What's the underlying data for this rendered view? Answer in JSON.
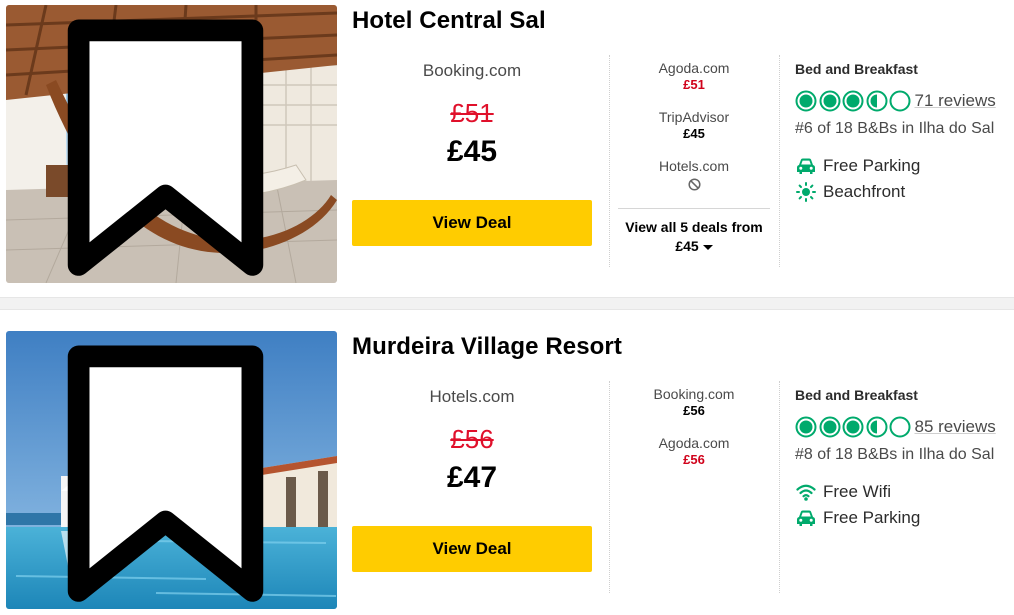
{
  "colors": {
    "accent_green": "#00aa6c",
    "deal_button": "#ffcc00",
    "strike_red": "#e0102b",
    "price_red": "#d0021b"
  },
  "hotels": [
    {
      "name": "Hotel Central Sal",
      "main_provider": "Booking.com",
      "old_price": "£51",
      "price": "£45",
      "view_deal": "View Deal",
      "other_deals": [
        {
          "provider": "Agoda.com",
          "price": "£51",
          "price_style": "red"
        },
        {
          "provider": "TripAdvisor",
          "price": "£45",
          "price_style": "normal"
        },
        {
          "provider": "Hotels.com",
          "price": "",
          "icon": "unavailable-icon"
        }
      ],
      "view_all_line1": "View all 5 deals from",
      "view_all_line2": "£45",
      "property_type": "Bed and Breakfast",
      "rating": 3.5,
      "reviews": "71 reviews",
      "rank": "#6 of 18 B&Bs in Ilha do Sal",
      "amenities": [
        {
          "icon": "car-icon",
          "label": "Free Parking"
        },
        {
          "icon": "sun-icon",
          "label": "Beachfront"
        }
      ]
    },
    {
      "name": "Murdeira Village Resort",
      "main_provider": "Hotels.com",
      "old_price": "£56",
      "price": "£47",
      "view_deal": "View Deal",
      "other_deals": [
        {
          "provider": "Booking.com",
          "price": "£56",
          "price_style": "normal"
        },
        {
          "provider": "Agoda.com",
          "price": "£56",
          "price_style": "red"
        }
      ],
      "property_type": "Bed and Breakfast",
      "rating": 3.5,
      "reviews": "85 reviews",
      "rank": "#8 of 18 B&Bs in Ilha do Sal",
      "amenities": [
        {
          "icon": "wifi-icon",
          "label": "Free Wifi"
        },
        {
          "icon": "car-icon",
          "label": "Free Parking"
        }
      ]
    }
  ]
}
